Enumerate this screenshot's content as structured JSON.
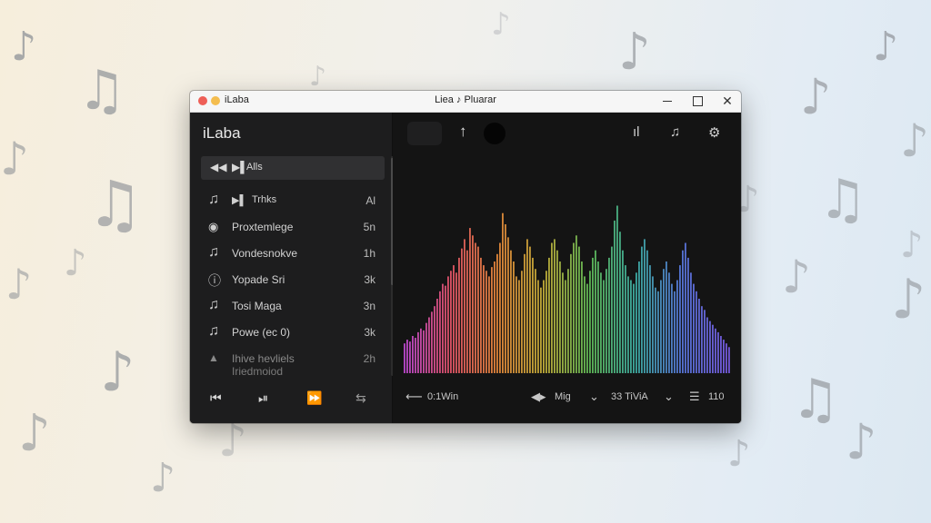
{
  "window": {
    "app_name": "iLaba",
    "title": "Liea ♪ Pluarar",
    "close_glyph": "✕"
  },
  "sidebar": {
    "title": "iLaba",
    "all_row": {
      "label": "Alls"
    },
    "items": [
      {
        "label": "Trhks",
        "value": "Al",
        "icon": "music-note-icon",
        "glyph": "♫"
      },
      {
        "label": "Proxtemlege",
        "value": "5n",
        "icon": "eye-icon",
        "glyph": "◉"
      },
      {
        "label": "Vondesnokve",
        "value": "1h",
        "icon": "music-note-icon",
        "glyph": "♫"
      },
      {
        "label": "Yopade Sri",
        "value": "3k",
        "icon": "info-circle-icon",
        "glyph": "ⓘ"
      },
      {
        "label": "Tosi Maga",
        "value": "3n",
        "icon": "music-note-icon",
        "glyph": "♫"
      },
      {
        "label": "Powe (ec 0)",
        "value": "3k",
        "icon": "music-note-icon",
        "glyph": "♫"
      },
      {
        "label": "Ihive hevliels",
        "label2": "Iriedmoiod",
        "value": "2h",
        "icon": "warning-icon",
        "glyph": "▲"
      }
    ],
    "controls": [
      {
        "name": "skip-back-button",
        "glyph": "⏮"
      },
      {
        "name": "play-pause-button",
        "glyph": "⏯"
      },
      {
        "name": "fast-forward-button",
        "glyph": "⏩"
      },
      {
        "name": "shuffle-button",
        "glyph": "⇆"
      }
    ]
  },
  "main": {
    "toolbar": {
      "up_glyph": "↑",
      "waveform_glyph": "ıl",
      "playlist_glyph": "♫",
      "settings_glyph": "⚙"
    },
    "bottom_bar": {
      "time_label": "0:1Win",
      "mode_label": "Mig",
      "rate_label": "33 TiViA",
      "count_label": "110"
    }
  },
  "visualizer": {
    "bar_count": 120,
    "bar_levels": [
      0.16,
      0.18,
      0.17,
      0.2,
      0.19,
      0.22,
      0.24,
      0.23,
      0.27,
      0.3,
      0.33,
      0.36,
      0.4,
      0.44,
      0.48,
      0.47,
      0.52,
      0.55,
      0.58,
      0.54,
      0.62,
      0.67,
      0.72,
      0.66,
      0.78,
      0.74,
      0.7,
      0.68,
      0.62,
      0.58,
      0.55,
      0.52,
      0.57,
      0.6,
      0.64,
      0.7,
      0.86,
      0.8,
      0.73,
      0.66,
      0.6,
      0.52,
      0.5,
      0.55,
      0.64,
      0.72,
      0.68,
      0.62,
      0.56,
      0.5,
      0.46,
      0.5,
      0.55,
      0.62,
      0.7,
      0.72,
      0.66,
      0.6,
      0.54,
      0.5,
      0.56,
      0.64,
      0.7,
      0.74,
      0.68,
      0.6,
      0.52,
      0.48,
      0.55,
      0.62,
      0.66,
      0.6,
      0.54,
      0.5,
      0.56,
      0.62,
      0.68,
      0.82,
      0.9,
      0.76,
      0.66,
      0.58,
      0.52,
      0.5,
      0.48,
      0.54,
      0.6,
      0.68,
      0.72,
      0.66,
      0.58,
      0.52,
      0.46,
      0.44,
      0.5,
      0.56,
      0.6,
      0.54,
      0.48,
      0.44,
      0.5,
      0.58,
      0.66,
      0.7,
      0.62,
      0.54,
      0.48,
      0.44,
      0.4,
      0.36,
      0.34,
      0.3,
      0.28,
      0.26,
      0.24,
      0.22,
      0.2,
      0.18,
      0.16,
      0.14
    ],
    "colors": [
      "#c34bd6",
      "#e8566a",
      "#e98a3c",
      "#c8b23a",
      "#62c05a",
      "#3fb0a8",
      "#5a78e0",
      "#7a5ce6"
    ]
  }
}
